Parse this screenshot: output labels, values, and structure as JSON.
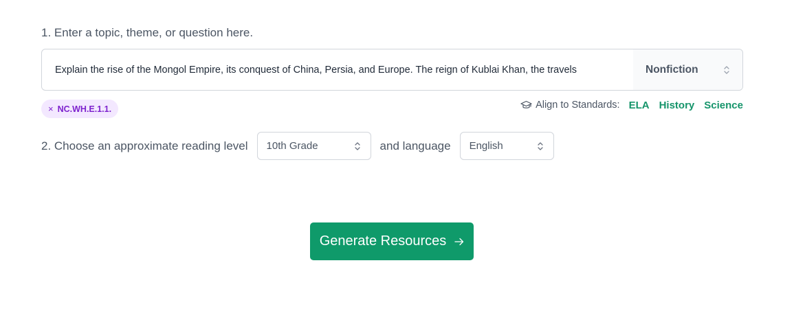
{
  "step1": {
    "label": "1. Enter a topic, theme, or question here.",
    "topic_value": "Explain the rise of the Mongol Empire, its conquest of China, Persia, and Europe. The reign of Kublai Khan, the travels",
    "genre_value": "Nonfiction"
  },
  "tags": [
    {
      "remove": "×",
      "code": "NC.WH.E.1.1."
    }
  ],
  "standards": {
    "label": "Align to Standards:",
    "links": [
      "ELA",
      "History",
      "Science"
    ]
  },
  "step2": {
    "label": "2. Choose an approximate reading level",
    "grade_value": "10th Grade",
    "connector": "and language",
    "language_value": "English"
  },
  "generate": {
    "label": "Generate Resources"
  },
  "colors": {
    "accent_green": "#0f9a6a",
    "link_green": "#15946a",
    "tag_bg": "#f3e8ff",
    "tag_text": "#7e22ce"
  }
}
